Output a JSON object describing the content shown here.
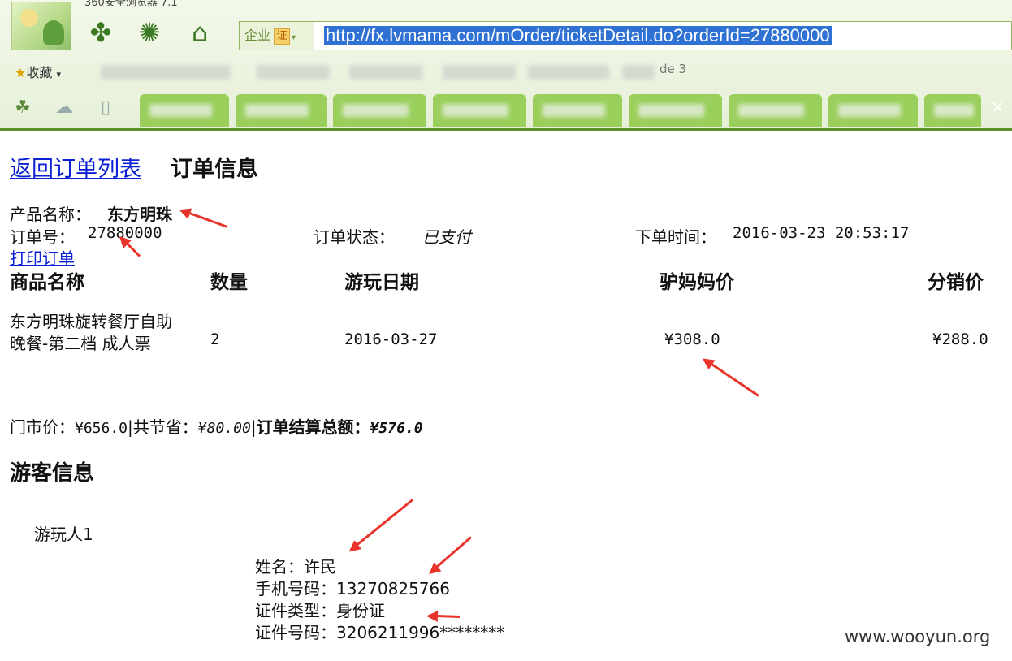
{
  "browser": {
    "title_partial": "360安全浏览器 7.1",
    "address_badge": "企业",
    "address_badge_icon": "证",
    "url": "http://fx.lvmama.com/mOrder/ticketDetail.do?orderId=27880000",
    "favorites_label": "收藏",
    "fav_partials": [
      "de 3"
    ]
  },
  "page": {
    "back_link": "返回订单列表",
    "title": "订单信息",
    "product_label": "产品名称：",
    "product_name": "东方明珠",
    "order_no_label": "订单号：",
    "order_no": "27880000",
    "status_label": "订单状态：",
    "status_value": "已支付",
    "time_label": "下单时间：",
    "time_value": "2016-03-23 20:53:17",
    "print_link": "打印订单"
  },
  "table": {
    "headers": [
      "商品名称",
      "数量",
      "游玩日期",
      "驴妈妈价",
      "分销价"
    ],
    "row": {
      "name_line1": "东方明珠旋转餐厅自助",
      "name_line2": "晚餐-第二档 成人票",
      "qty": "2",
      "date": "2016-03-27",
      "lvmama_price": "¥308.0",
      "dist_price": "¥288.0"
    }
  },
  "summary": {
    "market_label": "门市价：",
    "market_value": "¥656.0",
    "sep": "|",
    "save_label": "共节省：",
    "save_value": "¥80.00",
    "total_label": "订单结算总额：",
    "total_value": "¥576.0"
  },
  "visitor": {
    "section_title": "游客信息",
    "person_label": "游玩人1",
    "name_line": "姓名：许民",
    "phone_line": "手机号码：13270825766",
    "id_type_line": "证件类型：身份证",
    "id_no_line": "证件号码：3206211996********"
  },
  "watermark": "www.wooyun.org",
  "colors": {
    "link": "#0b1fd3",
    "arrow": "#e8342a",
    "chrome_green": "#9bcf5c",
    "url_highlight": "#3072d3"
  }
}
